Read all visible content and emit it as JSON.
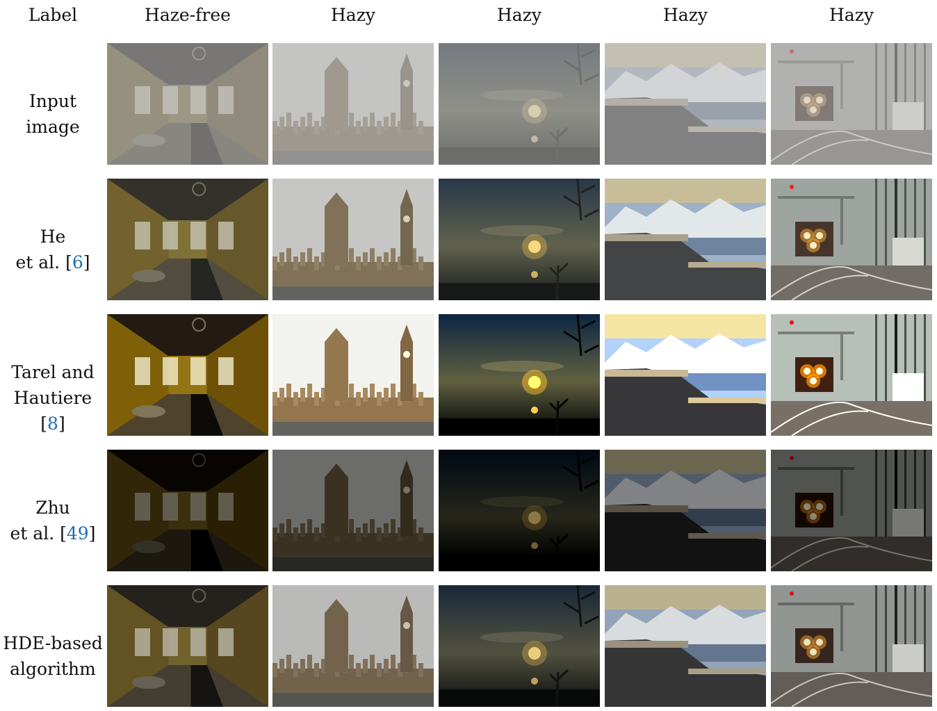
{
  "columns": [
    "Label",
    "Haze-free",
    "Hazy",
    "Hazy",
    "Hazy",
    "Hazy"
  ],
  "rows": [
    {
      "line1": "Input",
      "line2": "image",
      "cite": "",
      "suffix": ""
    },
    {
      "line1": "He",
      "line2": "et al. [",
      "cite": "6",
      "suffix": "]"
    },
    {
      "line1": "Tarel and",
      "line2": "Hautiere [",
      "cite": "8",
      "suffix": "]"
    },
    {
      "line1": "Zhu",
      "line2": "et al. [",
      "cite": "49",
      "suffix": "]"
    },
    {
      "line1": "HDE-based",
      "line2": "algorithm",
      "cite": "",
      "suffix": ""
    }
  ],
  "scenes": [
    "abandoned-room",
    "westminster-palace",
    "sunset-lake",
    "mountain-range",
    "train-lights"
  ],
  "colors": {
    "citation": "#1f6fb2"
  }
}
